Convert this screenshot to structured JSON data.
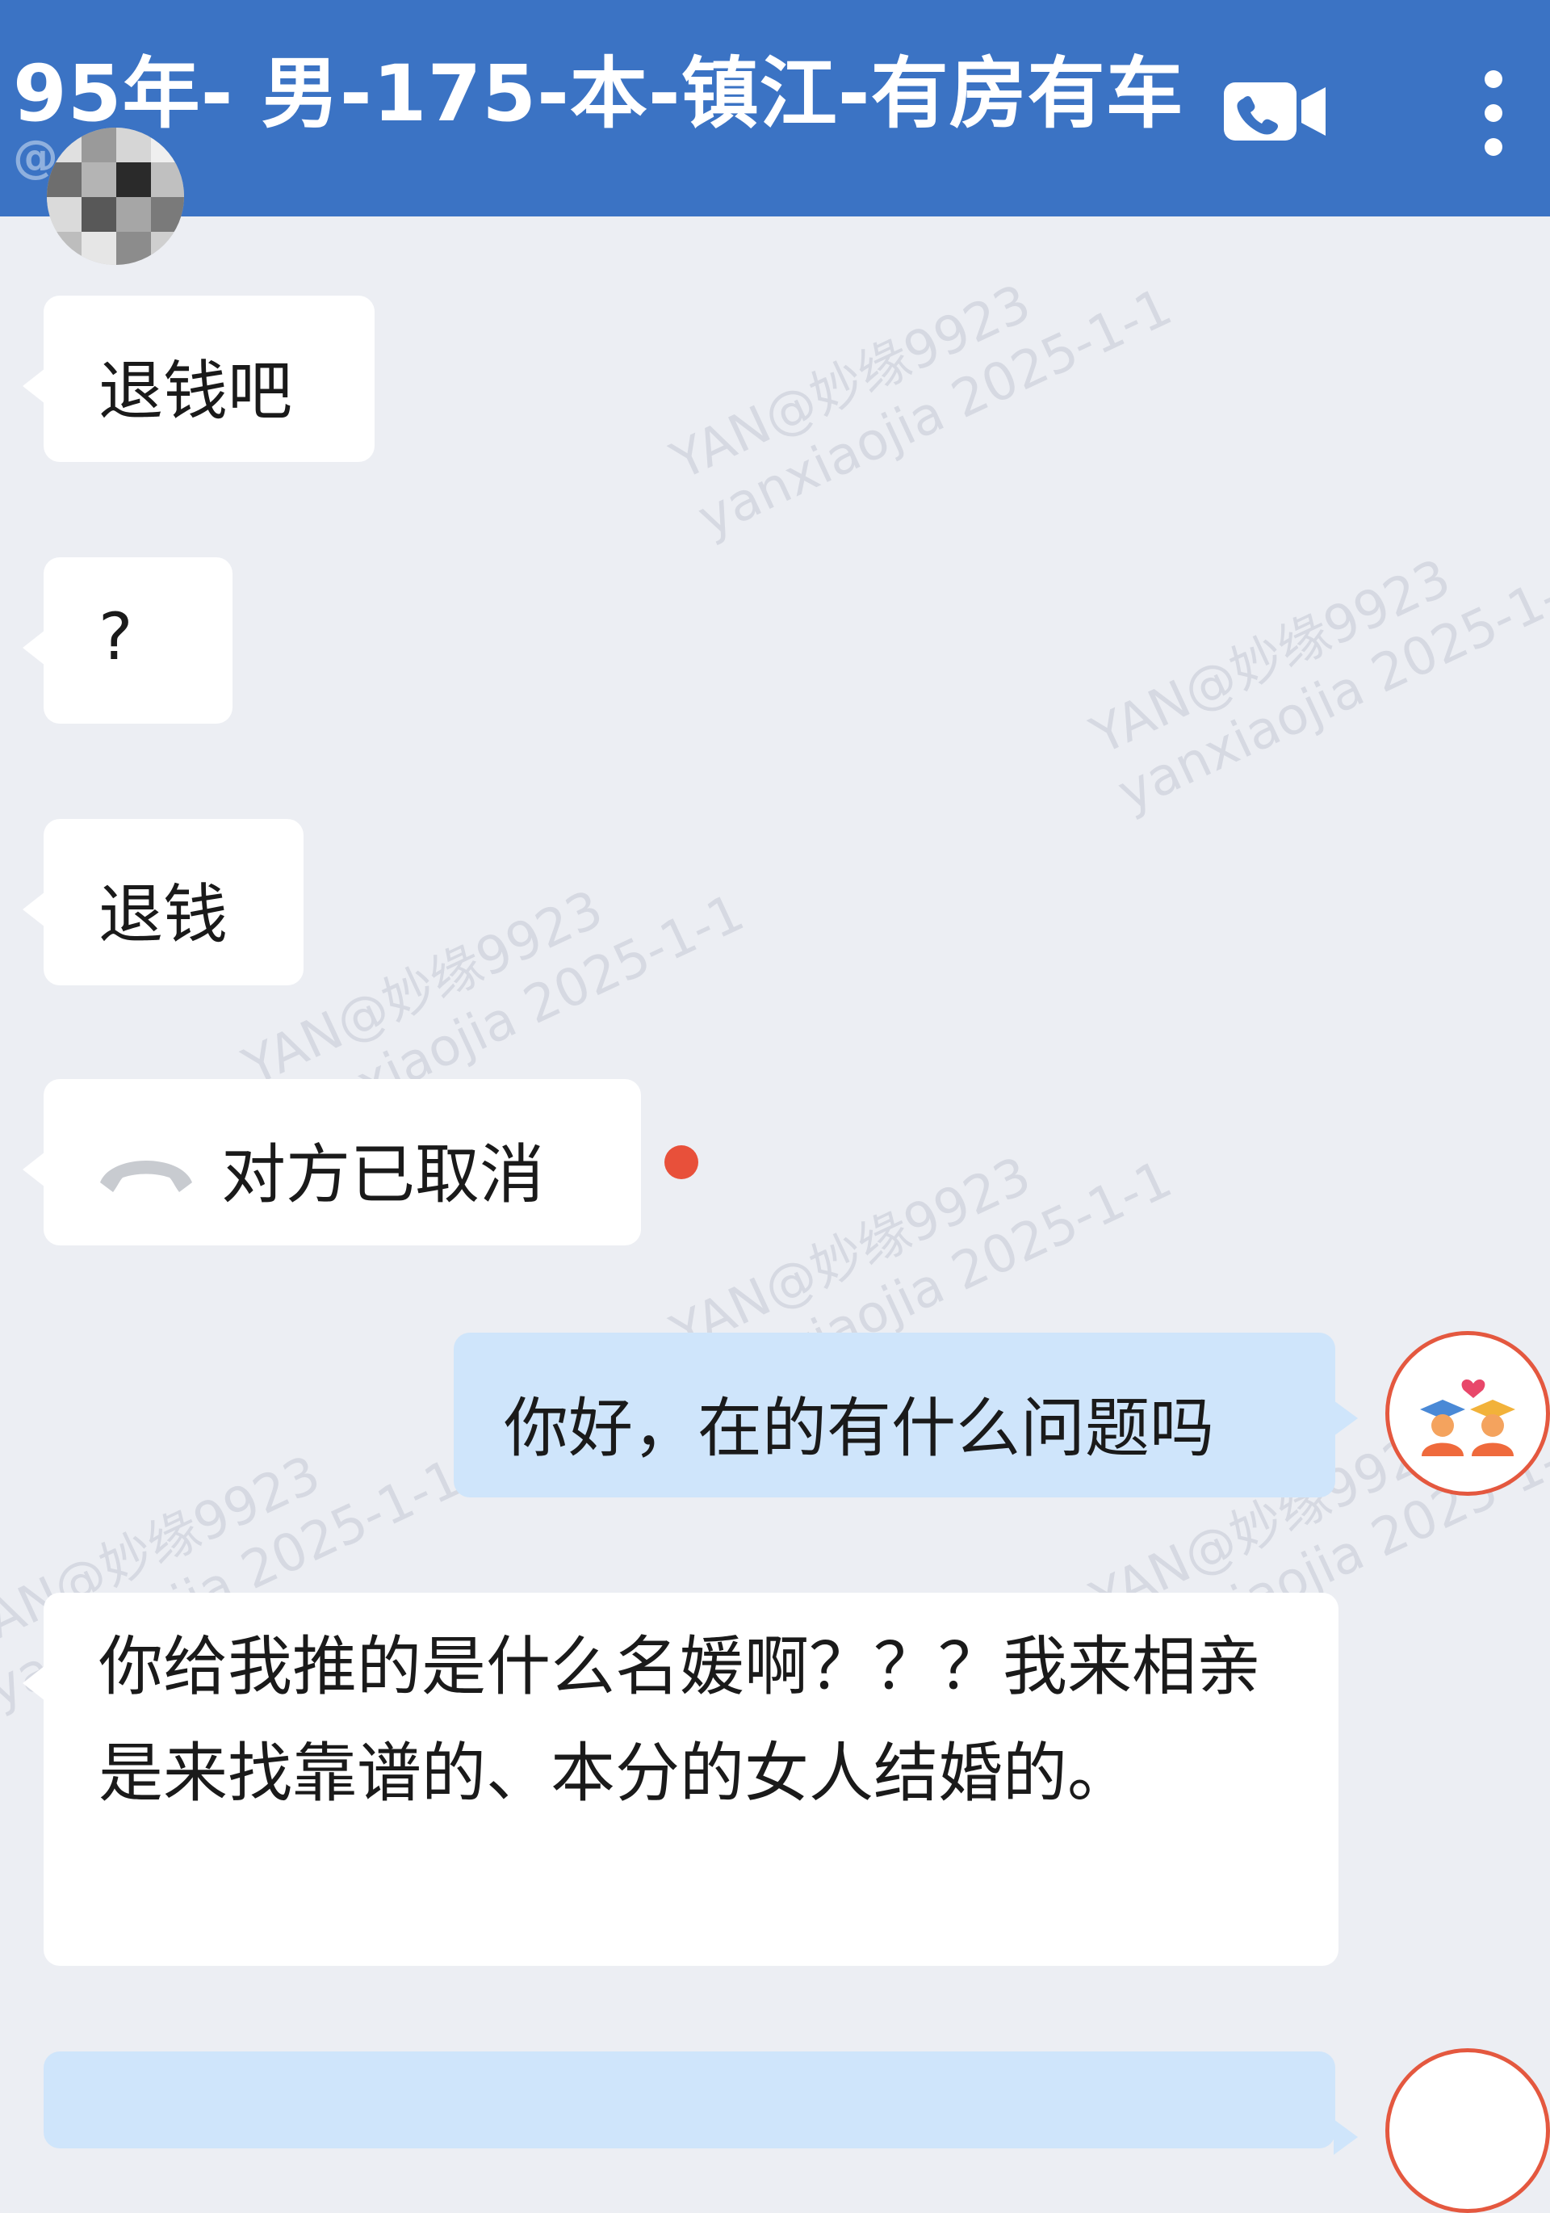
{
  "header": {
    "title": "95年- 男-175-本-镇江-有房有车",
    "subtitle": "@",
    "video_call_icon": "video-call-icon",
    "more_icon": "more-vertical-icon"
  },
  "watermark": {
    "line1": "YAN@妙缘9923",
    "line2": "yanxiaojia 2025-1-1"
  },
  "messages": [
    {
      "side": "in",
      "text": "退钱吧"
    },
    {
      "side": "in",
      "text": "?"
    },
    {
      "side": "in",
      "text": "退钱"
    },
    {
      "side": "in",
      "type": "call",
      "icon": "phone-hangup-icon",
      "text": "对方已取消",
      "unread": true
    },
    {
      "side": "out",
      "text": "你好，在的有什么问题吗"
    },
    {
      "side": "in",
      "text": "你给我推的是什么名媛啊？？？我来相亲是来找靠谱的、本分的女人结婚的。"
    }
  ],
  "colors": {
    "header_bg": "#3b73c4",
    "chat_bg": "#eceef3",
    "incoming_bubble": "#ffffff",
    "outgoing_bubble": "#cfe5fb",
    "unread_dot": "#e8503a"
  }
}
